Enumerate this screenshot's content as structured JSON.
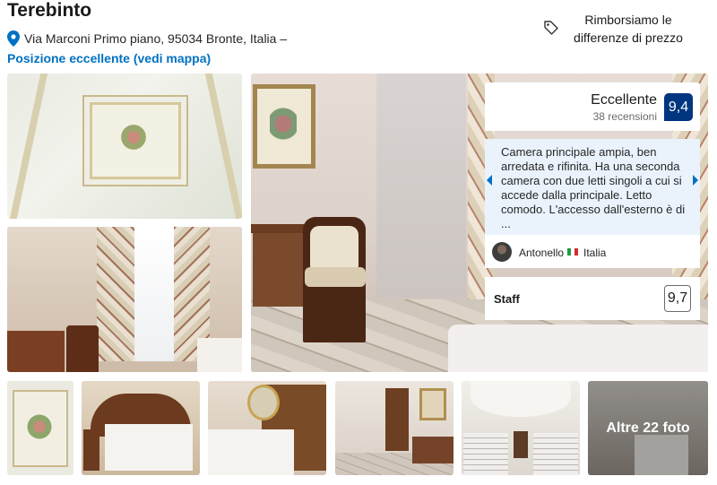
{
  "hotel": {
    "name": "Terebinto",
    "address": "Via Marconi Primo piano, 95034 Bronte, Italia –",
    "map_link": "Posizione eccellente (vedi mappa)"
  },
  "price_match": {
    "line1": "Rimborsiamo le",
    "line2": "differenze di prezzo",
    "icon": "tag-icon"
  },
  "rating": {
    "label": "Eccellente",
    "reviews": "38 recensioni",
    "score": "9,4"
  },
  "review": {
    "text": "Camera principale ampia, ben arredata e rifinita. Ha una seconda camera con due letti singoli a cui si accede dalla principale. Letto comodo. L'accesso dall'esterno è di ...",
    "author": "Antonello",
    "country": "Italia"
  },
  "staff": {
    "label": "Staff",
    "score": "9,7"
  },
  "gallery": {
    "more_photos": "Altre 22 foto"
  },
  "colors": {
    "brand_blue": "#003580",
    "link_blue": "#0071c2",
    "review_bg": "#eaf3fc"
  }
}
